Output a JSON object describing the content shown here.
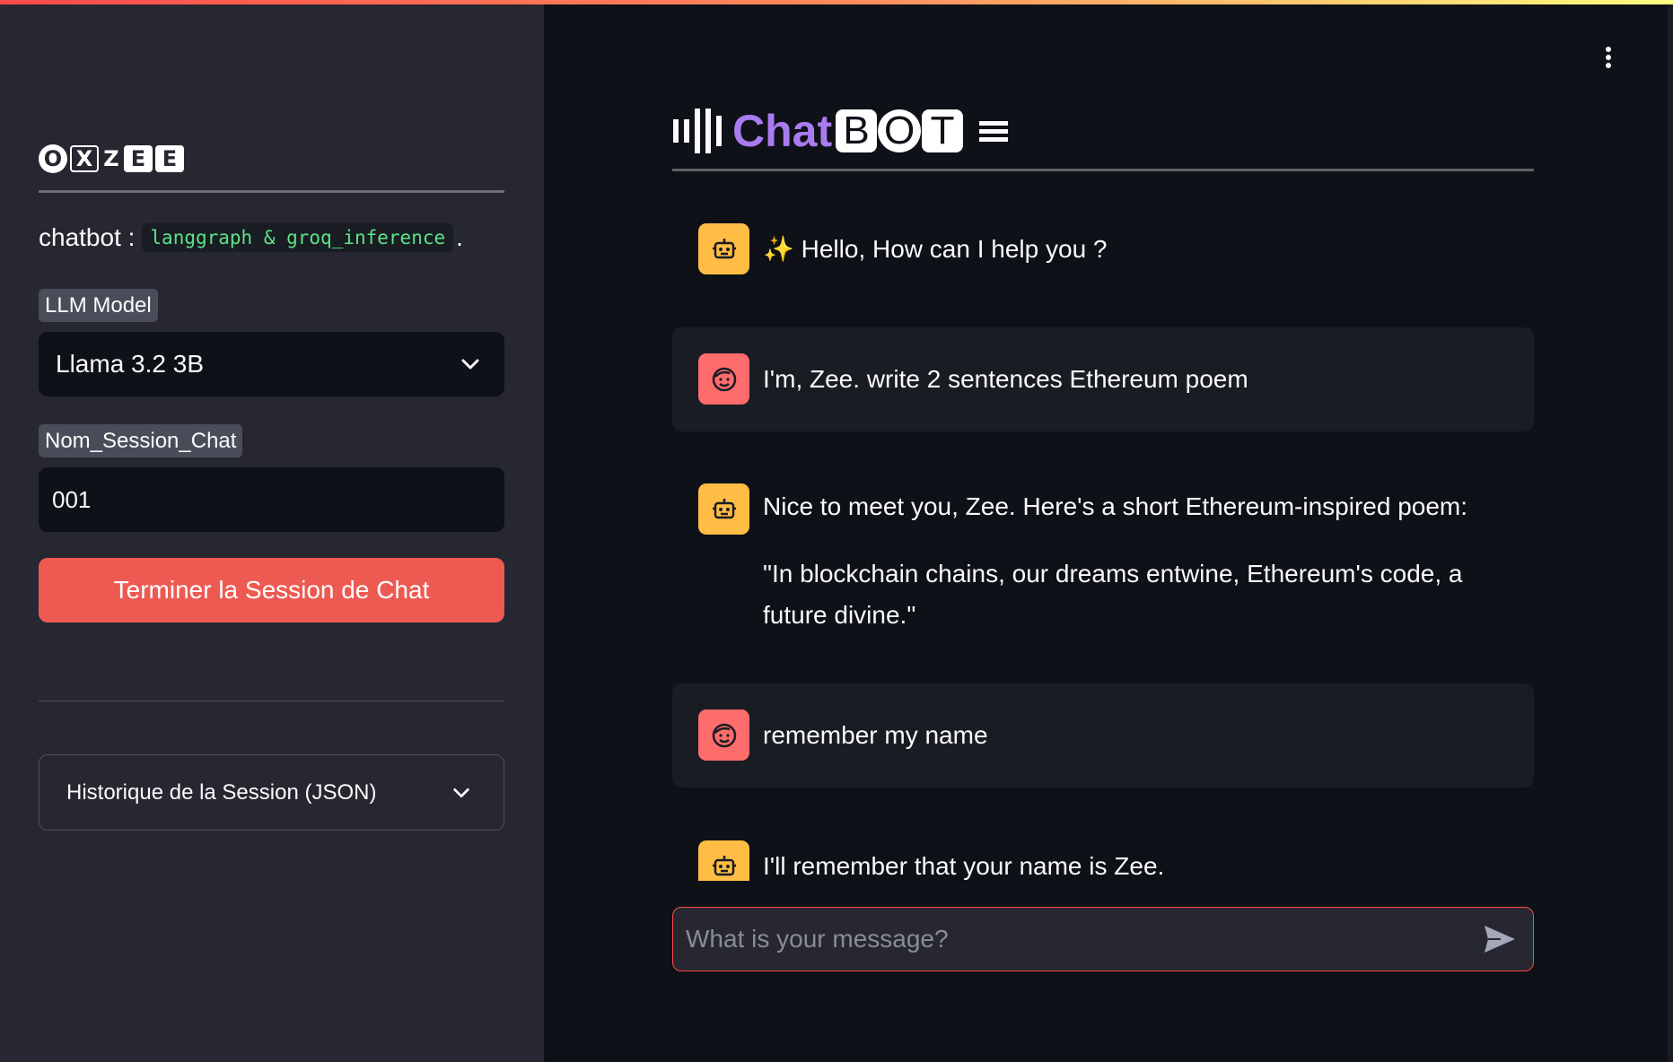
{
  "sidebar": {
    "logo": [
      "O",
      "X",
      "Z",
      "E",
      "E"
    ],
    "chatbot_label": "chatbot :",
    "chatbot_code": "langgraph & groq_inference",
    "chatbot_dot": ".",
    "model_label": "LLM Model",
    "model_value": "Llama 3.2 3B",
    "session_label": "Nom_Session_Chat",
    "session_value": "001",
    "end_button": "Terminer la Session de Chat",
    "history_expander": "Historique de la Session (JSON)"
  },
  "main": {
    "title_chat": "Chat",
    "title_letters": [
      "B",
      "O",
      "T"
    ],
    "messages": [
      {
        "role": "assistant",
        "text": "✨ Hello, How can I help you ?"
      },
      {
        "role": "user",
        "text": "I'm, Zee. write 2 sentences Ethereum poem"
      },
      {
        "role": "assistant",
        "text": "Nice to meet you, Zee. Here's a short Ethereum-inspired poem:",
        "text2": "\"In blockchain chains, our dreams entwine, Ethereum's code, a future divine.\""
      },
      {
        "role": "user",
        "text": "remember my name"
      },
      {
        "role": "assistant",
        "text": "I'll remember that your name is Zee."
      }
    ],
    "input_placeholder": "What is your message?"
  },
  "colors": {
    "accent": "#ff4b4b",
    "title_purple": "#a97bf0",
    "bot_avatar": "#ffbd45",
    "user_avatar": "#ff6c6c",
    "end_button": "#ee5a52"
  },
  "icons": {
    "bot_avatar": "robot-face-icon",
    "user_avatar": "smiling-face-icon",
    "send": "send-arrow-icon",
    "menu": "kebab-menu-icon"
  }
}
